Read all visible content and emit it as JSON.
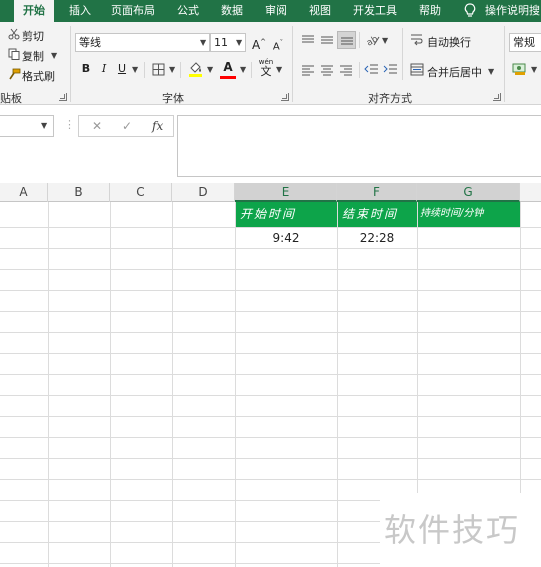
{
  "ribbon_tabs": [
    "开始",
    "插入",
    "页面布局",
    "公式",
    "数据",
    "审阅",
    "视图",
    "开发工具",
    "帮助",
    "操作说明搜"
  ],
  "clipboard": {
    "cut": "剪切",
    "copy": "复制",
    "format_painter": "格式刷",
    "group_label": "贴板"
  },
  "font": {
    "name": "等线",
    "size": "11",
    "grow": "A",
    "shrink": "A",
    "bold": "B",
    "italic": "I",
    "underline": "U",
    "font_color": "A",
    "wen": "wén",
    "wen_char": "文",
    "group_label": "字体"
  },
  "alignment": {
    "wrap_text": "自动换行",
    "merge_center": "合并后居中",
    "group_label": "对齐方式"
  },
  "number": {
    "format": "常规"
  },
  "formula_bar": {
    "fx": "fx",
    "cancel": "✕",
    "enter": "✓"
  },
  "columns": [
    "A",
    "B",
    "C",
    "D",
    "E",
    "F",
    "G"
  ],
  "sheet": {
    "header_start": "开始时间",
    "header_end": "结束时间",
    "header_duration": "持续时间/分钟",
    "start_time": "9:42",
    "end_time": "22:28"
  },
  "watermark": "软件技巧",
  "colors": {
    "accent": "#217346",
    "header_fill": "#0da44a"
  }
}
